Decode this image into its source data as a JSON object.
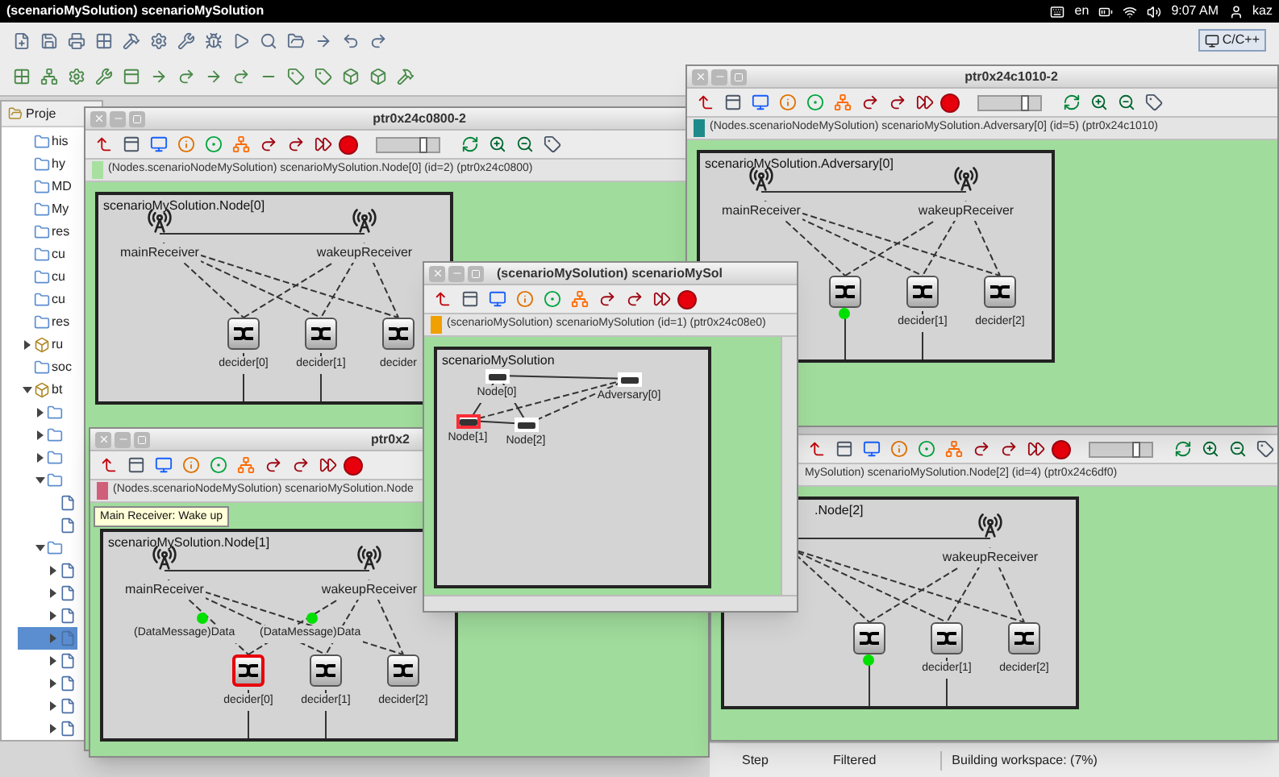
{
  "panel": {
    "title": "(scenarioMySolution) scenarioMySolution",
    "language": "en",
    "clock": "9:07 AM",
    "user": "kaz"
  },
  "perspective": "C/C++",
  "explorer": {
    "tab": "Proje",
    "items": [
      {
        "label": "his",
        "kind": "folder"
      },
      {
        "label": "hy",
        "kind": "folder"
      },
      {
        "label": "MD",
        "kind": "folder"
      },
      {
        "label": "My",
        "kind": "folder"
      },
      {
        "label": "res",
        "kind": "folder"
      },
      {
        "label": "cu",
        "kind": "folder"
      },
      {
        "label": "cu",
        "kind": "folder"
      },
      {
        "label": "cu",
        "kind": "folder"
      },
      {
        "label": "res",
        "kind": "folder"
      },
      {
        "label": "ru",
        "kind": "project",
        "expanded": false
      },
      {
        "label": "soc",
        "kind": "folder"
      },
      {
        "label": "bt",
        "kind": "project",
        "expanded": true,
        "children": [
          {
            "kind": "folder",
            "expanded": false
          },
          {
            "kind": "folder",
            "expanded": false
          },
          {
            "kind": "folder",
            "expanded": false
          },
          {
            "kind": "folder",
            "expanded": true,
            "children": [
              {
                "kind": "file"
              },
              {
                "kind": "file"
              }
            ]
          },
          {
            "kind": "folder",
            "expanded": true,
            "children": [
              {
                "kind": "file",
                "expanded": false,
                "selected": false
              },
              {
                "kind": "file",
                "expanded": false,
                "selected": false
              },
              {
                "kind": "file",
                "expanded": false,
                "selected": false
              },
              {
                "kind": "file",
                "expanded": false,
                "selected": true
              },
              {
                "kind": "file",
                "expanded": false,
                "selected": false
              },
              {
                "kind": "file",
                "expanded": false,
                "selected": false
              },
              {
                "kind": "file",
                "expanded": false,
                "selected": false
              },
              {
                "kind": "file",
                "expanded": false,
                "selected": false
              }
            ]
          }
        ]
      }
    ]
  },
  "windows": [
    {
      "title": "ptr0x24c0800-2",
      "info": {
        "color": "#a8e0a0",
        "text": "(Nodes.scenarioNodeMySolution) scenarioMySolution.Node[0] (id=2) (ptr0x24c0800)"
      },
      "speed_slider": {
        "level": 0.8
      },
      "module": {
        "kind": "node",
        "title": "scenarioMySolution.Node[0]",
        "receivers": [
          {
            "kind": "main",
            "label": "mainReceiver"
          },
          {
            "kind": "wakeup",
            "label": "wakeupReceiver"
          }
        ],
        "deciders": [
          {
            "label": "decider[0]",
            "selected": false
          },
          {
            "label": "decider[1]",
            "selected": false
          },
          {
            "label": "decider",
            "selected": false
          }
        ]
      }
    },
    {
      "title": "ptr0x24c1010-2",
      "info": {
        "color": "#1f8a8a",
        "text": "(Nodes.scenarioNodeMySolution) scenarioMySolution.Adversary[0] (id=5) (ptr0x24c1010)"
      },
      "speed_slider": {
        "level": 0.8
      },
      "module": {
        "kind": "node",
        "title": "scenarioMySolution.Adversary[0]",
        "receivers": [
          {
            "kind": "main",
            "label": "mainReceiver"
          },
          {
            "kind": "wakeup",
            "label": "wakeupReceiver"
          }
        ],
        "deciders": [
          {
            "selected": false
          },
          {
            "label": "decider[1]",
            "selected": false
          },
          {
            "label": "decider[2]",
            "selected": false
          }
        ],
        "messages": [
          {
            "kind": "arriving"
          }
        ]
      }
    },
    {
      "title": "ptr0x2",
      "info": {
        "color": "#d0607a",
        "text": "(Nodes.scenarioNodeMySolution) scenarioMySolution.Node"
      },
      "tooltip": "Main Receiver: Wake up",
      "module": {
        "kind": "node",
        "title": "scenarioMySolution.Node[1]",
        "receivers": [
          {
            "kind": "main",
            "label": "mainReceiver"
          },
          {
            "kind": "wakeup",
            "label": "wakeupReceiver"
          }
        ],
        "deciders": [
          {
            "label": "decider[0]",
            "selected": true
          },
          {
            "label": "decider[1]",
            "selected": false
          },
          {
            "label": "decider[2]",
            "selected": false
          }
        ],
        "messages": [
          {
            "kind": "in-flight",
            "label": "(DataMessage)Data"
          },
          {
            "kind": "in-flight",
            "label": "(DataMessage)Data"
          }
        ]
      }
    },
    {
      "info": {
        "text": "MySolution) scenarioMySolution.Node[2] (id=4) (ptr0x24c6df0)"
      },
      "speed_slider": {
        "level": 0.8
      },
      "module": {
        "kind": "node",
        "title": ".Node[2]",
        "receivers": [
          {
            "kind": "wakeup",
            "label": "wakeupReceiver"
          }
        ],
        "deciders": [
          {
            "selected": false
          },
          {
            "label": "decider[1]",
            "selected": false
          },
          {
            "label": "decider[2]",
            "selected": false
          }
        ],
        "messages": [
          {
            "kind": "arriving"
          }
        ]
      }
    },
    {
      "title": "(scenarioMySolution) scenarioMySol",
      "info": {
        "color": "#f0a000",
        "text": "(scenarioMySolution) scenarioMySolution (id=1) (ptr0x24c08e0)"
      },
      "module": {
        "kind": "network",
        "title": "scenarioMySolution",
        "nodes": [
          {
            "label": "Node[0]",
            "selected": false
          },
          {
            "label": "Adversary[0]",
            "selected": false
          },
          {
            "label": "Node[1]",
            "selected": true
          },
          {
            "label": "Node[2]",
            "selected": false
          }
        ]
      }
    }
  ],
  "status_bar": {
    "columns": [
      "Step",
      "Filtered"
    ],
    "progress": "Building workspace: (7%)"
  }
}
